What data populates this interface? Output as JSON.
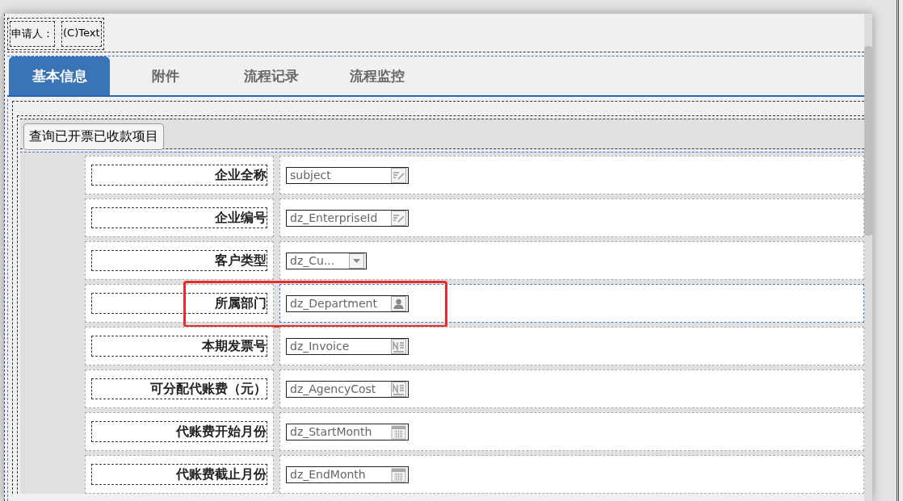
{
  "applicant": {
    "label": "申请人：",
    "value": "(C)Text"
  },
  "tabs": [
    {
      "label": "基本信息",
      "selected": true
    },
    {
      "label": "附件",
      "selected": false
    },
    {
      "label": "流程记录",
      "selected": false
    },
    {
      "label": "流程监控",
      "selected": false
    }
  ],
  "toolbar": {
    "button": "查询已开票已收款项目"
  },
  "fields": [
    {
      "label": "企业全称",
      "value": "subject",
      "kind": "edit",
      "highlighted": false
    },
    {
      "label": "企业编号",
      "value": "dz_EnterpriseId",
      "kind": "edit",
      "highlighted": false
    },
    {
      "label": "客户类型",
      "value": "dz_Cu...",
      "kind": "select",
      "highlighted": false
    },
    {
      "label": "所属部门",
      "value": "dz_Department",
      "kind": "user",
      "highlighted": true
    },
    {
      "label": "本期发票号",
      "value": "dz_Invoice",
      "kind": "number",
      "highlighted": false
    },
    {
      "label": "可分配代账费（元）",
      "value": "dz_AgencyCost",
      "kind": "number",
      "highlighted": false
    },
    {
      "label": "代账费开始月份",
      "value": "dz_StartMonth",
      "kind": "date",
      "highlighted": false
    },
    {
      "label": "代账费截止月份",
      "value": "dz_EndMonth",
      "kind": "date",
      "highlighted": false
    }
  ]
}
